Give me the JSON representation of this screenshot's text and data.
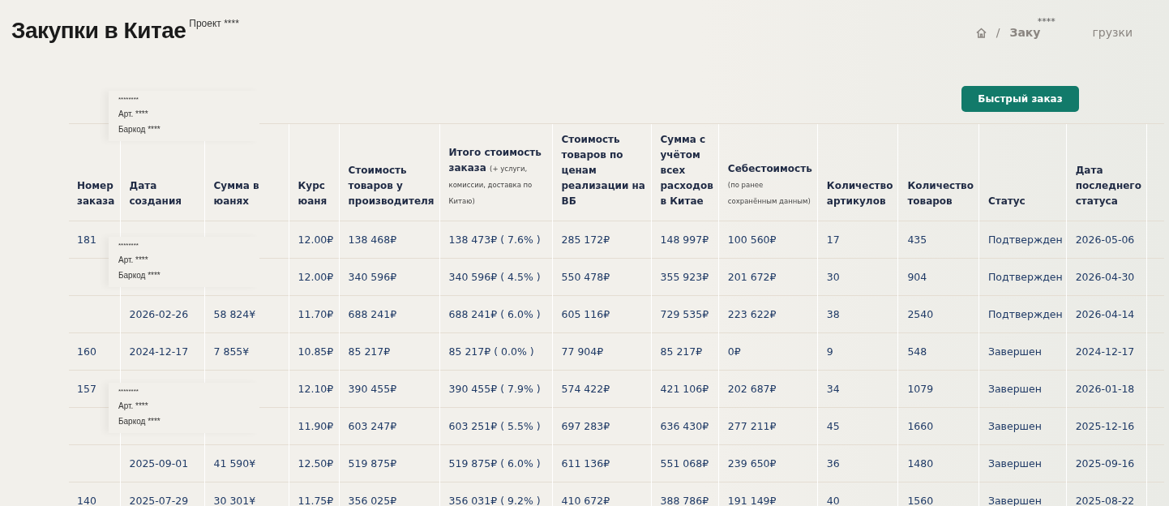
{
  "page": {
    "title": "Закупки в Китае",
    "project": "Проект ****"
  },
  "breadcrumb": {
    "separator": "/",
    "items": [
      "Заку",
      "грузки"
    ],
    "mask": "****"
  },
  "quick_order_button": "Быстрый заказ",
  "table": {
    "columns": [
      {
        "label": "Номер заказа"
      },
      {
        "label": "Дата создания"
      },
      {
        "label": "Сумма в юанях"
      },
      {
        "label": "Курс юаня"
      },
      {
        "label": "Стоимость товаров у производителя"
      },
      {
        "label": "Итого стоимость заказа",
        "note": "(+ услуги, комиссии, доставка по Китаю)"
      },
      {
        "label": "Стоимость товаров по ценам реализации на ВБ"
      },
      {
        "label": "Сумма с учётом всех расходов в Китае"
      },
      {
        "label": "Себестоимость",
        "note": "(по ранее сохранённым данным)"
      },
      {
        "label": "Количество артикулов"
      },
      {
        "label": "Количество товаров"
      },
      {
        "label": "Статус"
      },
      {
        "label": "Дата последнего статуса"
      }
    ],
    "rows": [
      [
        "181",
        null,
        null,
        "12.00₽",
        "138 468₽",
        "138 473₽ ( 7.6% )",
        "285 172₽",
        "148 997₽",
        "100 560₽",
        "17",
        "435",
        "Подтвержден",
        "2026-05-06"
      ],
      [
        null,
        null,
        null,
        "12.00₽",
        "340 596₽",
        "340 596₽ ( 4.5% )",
        "550 478₽",
        "355 923₽",
        "201 672₽",
        "30",
        "904",
        "Подтвержден",
        "2026-04-30"
      ],
      [
        null,
        "2026-02-26",
        "58 824¥",
        "11.70₽",
        "688 241₽",
        "688 241₽ ( 6.0% )",
        "605 116₽",
        "729 535₽",
        "223 622₽",
        "38",
        "2540",
        "Подтвержден",
        "2026-04-14"
      ],
      [
        "160",
        "2024-12-17",
        "7 855¥",
        "10.85₽",
        "85 217₽",
        "85 217₽ ( 0.0% )",
        "77 904₽",
        "85 217₽",
        "0₽",
        "9",
        "548",
        "Завершен",
        "2024-12-17"
      ],
      [
        "157",
        null,
        null,
        "12.10₽",
        "390 455₽",
        "390 455₽ ( 7.9% )",
        "574 422₽",
        "421 106₽",
        "202 687₽",
        "34",
        "1079",
        "Завершен",
        "2026-01-18"
      ],
      [
        null,
        null,
        null,
        "11.90₽",
        "603 247₽",
        "603 251₽ ( 5.5% )",
        "697 283₽",
        "636 430₽",
        "277 211₽",
        "45",
        "1660",
        "Завершен",
        "2025-12-16"
      ],
      [
        null,
        "2025-09-01",
        "41 590¥",
        "12.50₽",
        "519 875₽",
        "519 875₽ ( 6.0% )",
        "611 136₽",
        "551 068₽",
        "239 650₽",
        "36",
        "1480",
        "Завершен",
        "2025-09-16"
      ],
      [
        "140",
        "2025-07-29",
        "30 301¥",
        "11.75₽",
        "356 025₽",
        "356 031₽ ( 9.2% )",
        "410 672₽",
        "388 786₽",
        "191 149₽",
        "40",
        "1560",
        "Завершен",
        "2025-08-22"
      ]
    ]
  },
  "popups": [
    {
      "name": "********",
      "article": "Арт. ****",
      "barcode": "Баркод ****"
    },
    {
      "name": "********",
      "article": "Арт. ****",
      "barcode": "Баркод ****"
    },
    {
      "name": "********",
      "article": "Арт. ****",
      "barcode": "Баркод ****"
    }
  ]
}
